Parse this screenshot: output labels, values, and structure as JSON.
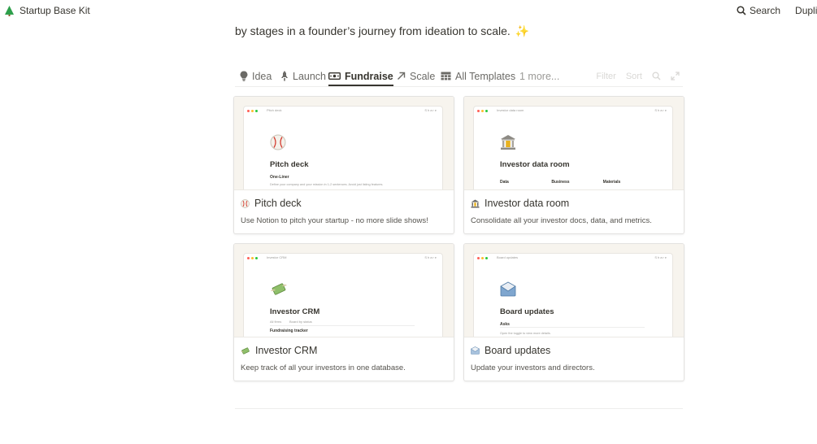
{
  "app": {
    "title": "Startup Base Kit",
    "icon": "tree-icon"
  },
  "topbar": {
    "search_label": "Search",
    "duplicate_label": "Duplicat"
  },
  "intro": {
    "text": "by stages in a founder’s journey from ideation to scale.",
    "sparkle": "✨"
  },
  "tabs": [
    {
      "label": "Idea",
      "icon": "lightbulb-icon",
      "active": false
    },
    {
      "label": "Launch",
      "icon": "rocket-icon",
      "active": false
    },
    {
      "label": "Fundraise",
      "icon": "money-icon",
      "active": true
    },
    {
      "label": "Scale",
      "icon": "arrow-up-right-icon",
      "active": false
    },
    {
      "label": "All Templates",
      "icon": "grid-icon",
      "active": false
    }
  ],
  "tabs_more": "1 more...",
  "view_actions": {
    "filter": "Filter",
    "sort": "Sort"
  },
  "cards": [
    {
      "title": "Pitch deck",
      "description": "Use Notion to pitch your startup - no more slide shows!",
      "icon": "baseball-icon",
      "preview": {
        "crumb": "Pitch deck",
        "heading": "Pitch deck",
        "subheading": "One-Liner",
        "small": "Define your company and your mission in 1-2 sentences. Avoid just listing features."
      }
    },
    {
      "title": "Investor data room",
      "description": "Consolidate all your investor docs, data, and metrics.",
      "icon": "bank-icon",
      "preview": {
        "crumb": "Investor data room",
        "heading": "Investor data room",
        "columns": [
          "Data",
          "Business",
          "Materials"
        ]
      }
    },
    {
      "title": "Investor CRM",
      "description": "Keep track of all your investors in one database.",
      "icon": "money-wings-icon",
      "preview": {
        "crumb": "Investor CRM",
        "heading": "Investor CRM",
        "subheading": "All firms",
        "subheading2": "Board by status",
        "small": "Fundraising tracker"
      }
    },
    {
      "title": "Board updates",
      "description": "Update your investors and directors.",
      "icon": "envelope-icon",
      "preview": {
        "crumb": "Board updates",
        "heading": "Board updates",
        "subheading": "Asks",
        "small": "Open the toggle to view more details."
      }
    }
  ],
  "mock_bar": {
    "share": "Share"
  },
  "colors": {
    "text": "#37352f",
    "muted": "#9b9a97",
    "preview_bg": "#f7f4ee",
    "sparkle": "#f5b915",
    "brand_green": "#2e9f4b"
  }
}
